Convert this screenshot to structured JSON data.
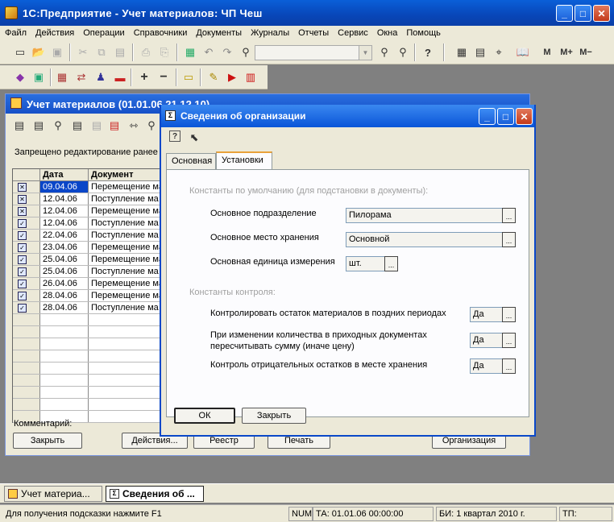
{
  "app": {
    "title": "1С:Предприятие - Учет материалов: ЧП Чеш",
    "btn_min": "_",
    "btn_max": "□",
    "btn_close": "✕"
  },
  "menu": [
    "Файл",
    "Действия",
    "Операции",
    "Справочники",
    "Документы",
    "Журналы",
    "Отчеты",
    "Сервис",
    "Окна",
    "Помощь"
  ],
  "toolbar": {
    "icons_row1": [
      "новый",
      "открыть",
      "сохранить",
      "вырезать",
      "копировать",
      "вставить",
      "печать",
      "предпросмотр",
      "калькулятор",
      "отменить",
      "повторить",
      "найти",
      "найти-далее",
      "заменить",
      "справка",
      "календарь",
      "табло",
      "иконка",
      "книга"
    ],
    "m": "M",
    "mplus": "M+",
    "mminus": "M−",
    "combo_value": ""
  },
  "journal": {
    "title": "Учет материалов  (01.01.06  21.12.10)",
    "notice": "Запрещено редактирование ранее",
    "col_date": "Дата",
    "col_doc": "Документ",
    "rows": [
      {
        "icon": "x",
        "date": "09.04.06",
        "doc": "Перемещение ма"
      },
      {
        "icon": "x",
        "date": "12.04.06",
        "doc": "Поступление ма"
      },
      {
        "icon": "x",
        "date": "12.04.06",
        "doc": "Перемещение ма"
      },
      {
        "icon": "v",
        "date": "12.04.06",
        "doc": "Поступление ма"
      },
      {
        "icon": "v",
        "date": "22.04.06",
        "doc": "Поступление ма"
      },
      {
        "icon": "v",
        "date": "23.04.06",
        "doc": "Перемещение ма"
      },
      {
        "icon": "v",
        "date": "25.04.06",
        "doc": "Перемещение ма"
      },
      {
        "icon": "v",
        "date": "25.04.06",
        "doc": "Поступление ма"
      },
      {
        "icon": "v",
        "date": "26.04.06",
        "doc": "Перемещение ма"
      },
      {
        "icon": "v",
        "date": "28.04.06",
        "doc": "Перемещение ма"
      },
      {
        "icon": "v",
        "date": "28.04.06",
        "doc": "Поступление ма"
      }
    ],
    "comment_label": "Комментарий:",
    "btn_close": "Закрыть",
    "btn_actions": "Действия...",
    "btn_registry": "Реестр",
    "btn_print": "Печать",
    "btn_org": "Организация"
  },
  "dialog": {
    "title": "Сведения об организации",
    "tab1": "Основная",
    "tab2": "Установки",
    "group1": "Константы по умолчанию (для подстановки в документы):",
    "f1_label": "Основное подразделение",
    "f1_value": "Пилорама",
    "f2_label": "Основное место хранения",
    "f2_value": "Основной",
    "f3_label": "Основная единица измерения",
    "f3_value": "шт.",
    "group2": "Константы контроля:",
    "c1_label": "Контролировать остаток материалов в поздних периодах",
    "c1_value": "Да",
    "c2_label1": "При изменении количества в приходных документах",
    "c2_label2": "пересчитывать сумму (иначе цену)",
    "c2_value": "Да",
    "c3_label": "Контроль отрицательных остатков в месте хранения",
    "c3_value": "Да",
    "ellipsis": "...",
    "btn_ok": "ОК",
    "btn_close": "Закрыть"
  },
  "taskbar": {
    "t1": "Учет материа...",
    "t2": "Сведения об ..."
  },
  "status": {
    "hint": "Для получения подсказки нажмите F1",
    "num": "NUM",
    "ta": "ТА: 01.01.06  00:00:00",
    "bi": "БИ: 1 квартал 2010 г.",
    "tp": "ТП:"
  }
}
